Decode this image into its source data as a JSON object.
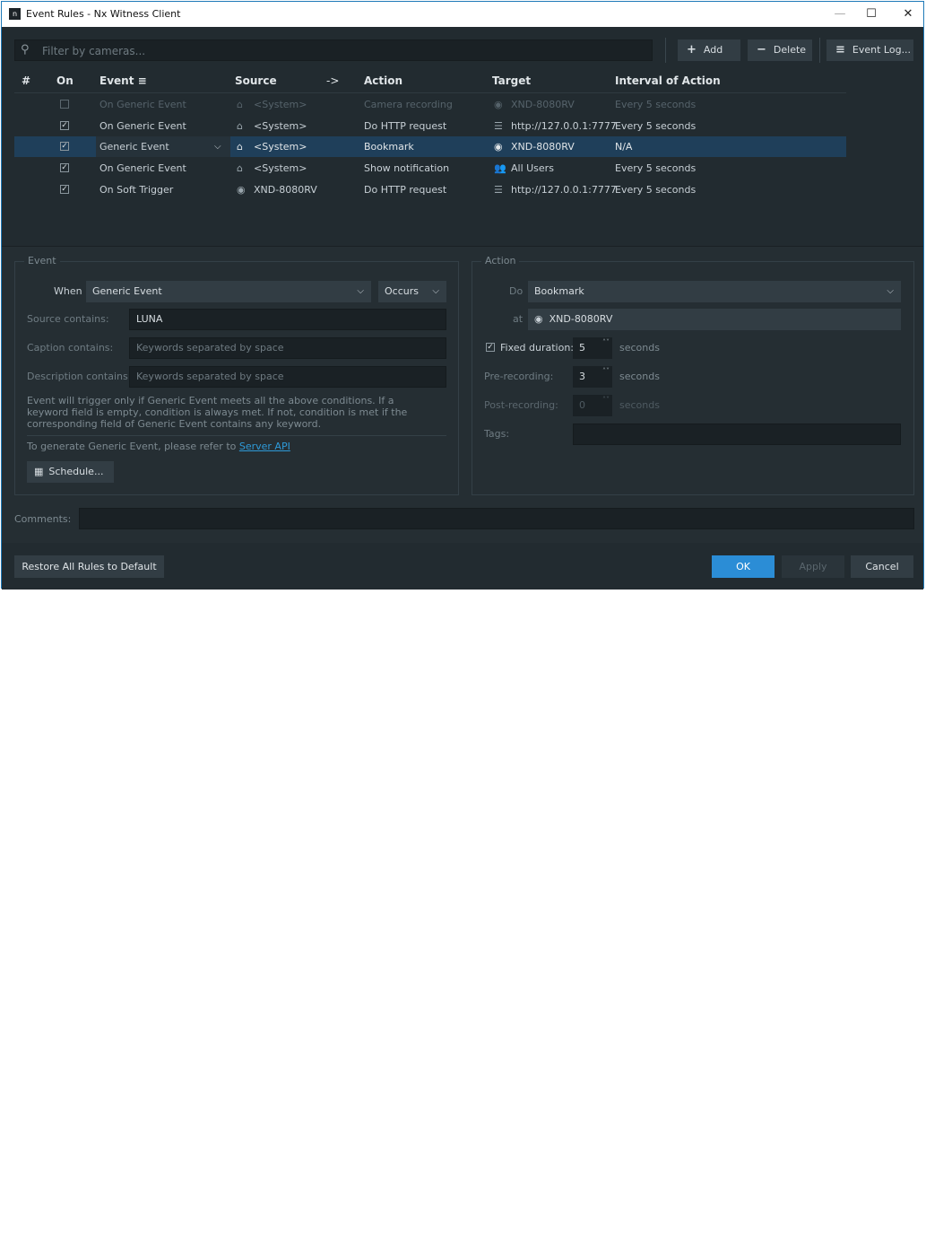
{
  "window": {
    "title": "Event Rules - Nx Witness Client",
    "logo": "n"
  },
  "window_controls": {
    "minimize": "—",
    "maximize": "☐",
    "close": "✕"
  },
  "toolbar": {
    "search_placeholder": "Filter by cameras...",
    "add_label": "Add",
    "delete_label": "Delete",
    "event_log_label": "Event Log..."
  },
  "table": {
    "headers": {
      "num": "#",
      "on": "On",
      "event": "Event",
      "source": "Source",
      "arrow": "->",
      "action": "Action",
      "target": "Target",
      "interval": "Interval of Action"
    },
    "rows": [
      {
        "on": false,
        "event": "On Generic Event",
        "source_icon": "home-icon",
        "source": "<System>",
        "action": "Camera recording",
        "target_icon": "camera-icon",
        "target": "XND-8080RV",
        "interval": "Every 5 seconds",
        "dimmed": true
      },
      {
        "on": true,
        "event": "On Generic Event",
        "source_icon": "home-icon",
        "source": "<System>",
        "action": "Do HTTP request",
        "target_icon": "http-icon",
        "target": "http://127.0.0.1:7777",
        "interval": "Every 5 seconds",
        "dimmed": false
      },
      {
        "on": true,
        "event": "Generic Event",
        "source_icon": "home-icon",
        "source": "<System>",
        "action": "Bookmark",
        "target_icon": "camera-icon",
        "target": "XND-8080RV",
        "interval": "N/A",
        "dimmed": false,
        "selected": true
      },
      {
        "on": true,
        "event": "On Generic Event",
        "source_icon": "home-icon",
        "source": "<System>",
        "action": "Show notification",
        "target_icon": "users-icon",
        "target": "All Users",
        "interval": "Every 5 seconds",
        "dimmed": false
      },
      {
        "on": true,
        "event": "On Soft Trigger",
        "source_icon": "camera-icon",
        "source": "XND-8080RV",
        "action": "Do HTTP request",
        "target_icon": "http-icon",
        "target": "http://127.0.0.1:7777",
        "interval": "Every 5 seconds",
        "dimmed": false
      }
    ]
  },
  "event_panel": {
    "title": "Event",
    "when_label": "When",
    "when_value": "Generic Event",
    "occurs_value": "Occurs",
    "source_label": "Source contains:",
    "source_value": "LUNA",
    "caption_label": "Caption contains:",
    "caption_placeholder": "Keywords separated by space",
    "description_label": "Description contains:",
    "description_placeholder": "Keywords separated by space",
    "note": "Event will trigger only if Generic Event meets all the above conditions. If a keyword field is empty, condition is always met. If not, condition is met if the corresponding field of Generic Event contains any keyword.",
    "api_text": "To generate Generic Event, please refer to",
    "api_link": "Server API",
    "schedule_label": "Schedule..."
  },
  "action_panel": {
    "title": "Action",
    "do_label": "Do",
    "do_value": "Bookmark",
    "at_label": "at",
    "at_value": "XND-8080RV",
    "fixed_label": "Fixed duration:",
    "fixed_checked": true,
    "fixed_value": "5",
    "pre_label": "Pre-recording:",
    "pre_value": "3",
    "post_label": "Post-recording:",
    "post_value": "0",
    "unit": "seconds",
    "tags_label": "Tags:"
  },
  "comments_label": "Comments:",
  "footer": {
    "restore_label": "Restore All Rules to Default",
    "ok_label": "OK",
    "apply_label": "Apply",
    "cancel_label": "Cancel"
  },
  "icons": {
    "home": "⌂",
    "camera": "◉",
    "http": "☰",
    "users": "👥",
    "check": "✓",
    "chevron": "⌵",
    "search": "⚲",
    "plus": "+",
    "minus": "−",
    "list": "≡",
    "calendar": "▦",
    "spin": "˄˅",
    "sort": "≡"
  },
  "colors": {
    "accent": "#2b8dd6",
    "selection": "#1f3f5a",
    "background": "#222b30"
  }
}
